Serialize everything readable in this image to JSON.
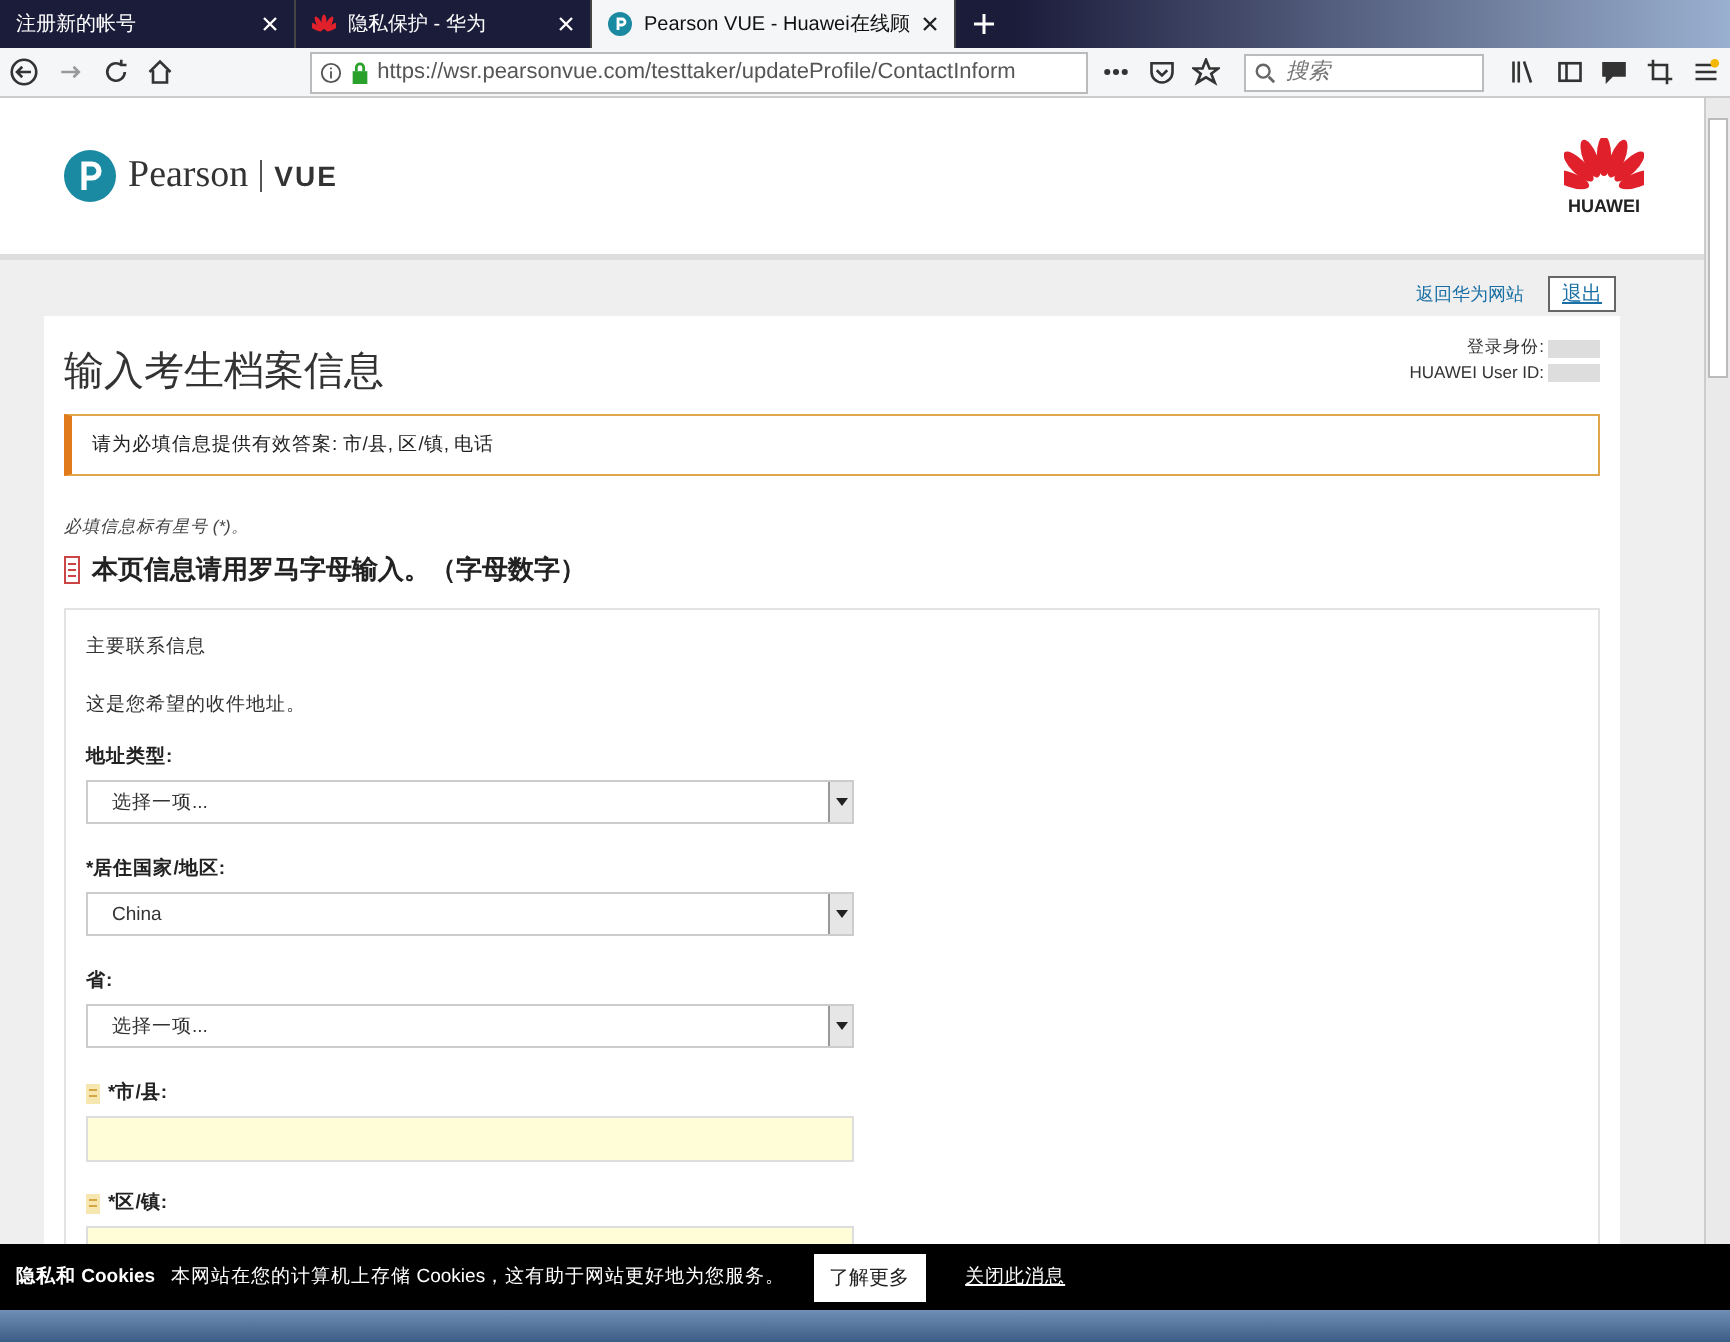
{
  "browser": {
    "tabs": [
      {
        "title": "注册新的帐号",
        "selected": false,
        "kind": "plain"
      },
      {
        "title": "隐私保护 - 华为",
        "selected": false,
        "kind": "partner"
      },
      {
        "title": "Pearson VUE - Huawei在线顾",
        "selected": true,
        "kind": "vendor"
      }
    ],
    "url_host": "https://wsr.pearsonvue.com",
    "url_path": "/testtaker/updateProfile/ContactInform",
    "search_placeholder": "搜索"
  },
  "header": {
    "brand": "Pearson",
    "product": "VUE",
    "partner": "HUAWEI"
  },
  "top_links": {
    "back": "返回华为网站",
    "logout": "退出"
  },
  "page": {
    "title": "输入考生档案信息",
    "login_label": "登录身份:",
    "user_id_label": "HUAWEI User ID:",
    "alert": "请为必填信息提供有效答案: 市/县, 区/镇, 电话",
    "required_note": "必填信息标有星号 (*)。",
    "roman_note": "本页信息请用罗马字母输入。（字母数字）"
  },
  "section": {
    "title": "主要联系信息",
    "description": "这是您希望的收件地址。",
    "fields": [
      {
        "kind": "select",
        "label": "地址类型:",
        "value": "选择一项..."
      },
      {
        "kind": "select",
        "label": "*居住国家/地区:",
        "value": "China"
      },
      {
        "kind": "select",
        "label": "省:",
        "value": "选择一项..."
      },
      {
        "kind": "text",
        "label": "*市/县:"
      },
      {
        "kind": "text",
        "label": "*区/镇:"
      }
    ]
  },
  "cookie_bar": {
    "title": "隐私和 Cookies",
    "text": "本网站在您的计算机上存储 Cookies，这有助于网站更好地为您服务。",
    "button": "了解更多",
    "link": "关闭此消息"
  }
}
